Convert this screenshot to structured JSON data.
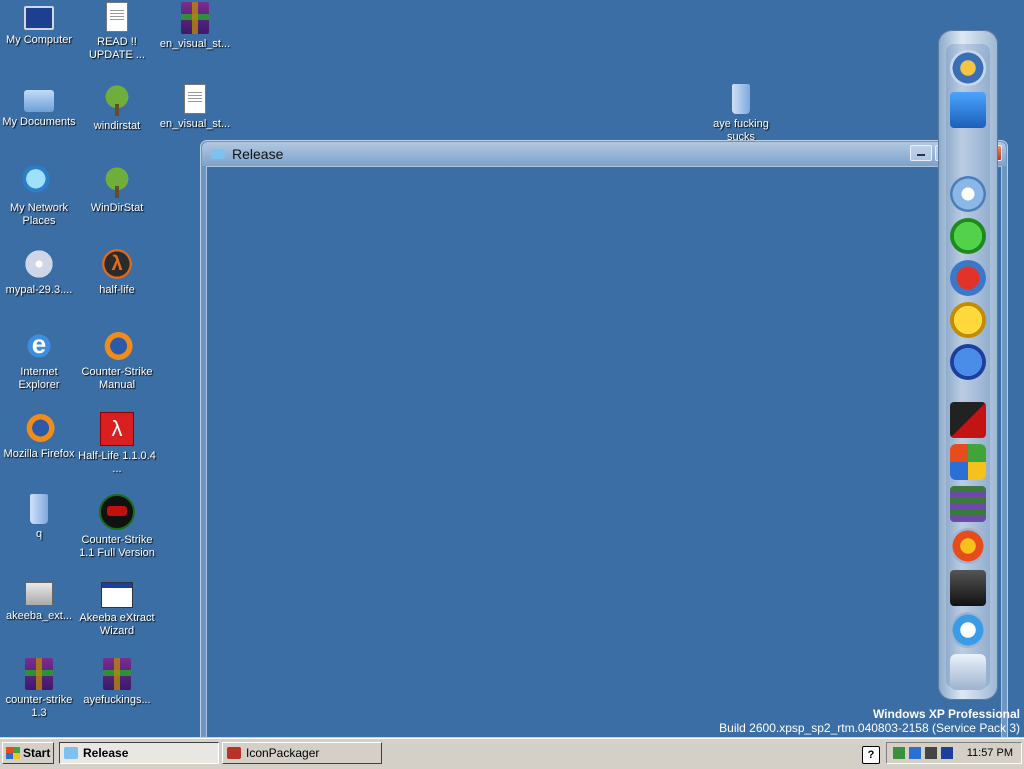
{
  "desktop_icons": [
    {
      "label": "My Computer",
      "icon": "computer-icon"
    },
    {
      "label": "READ !! UPDATE ...",
      "icon": "text-document-icon"
    },
    {
      "label": "en_visual_st...",
      "icon": "winrar-archive-icon"
    },
    {
      "label": "My Documents",
      "icon": "my-documents-icon"
    },
    {
      "label": "windirstat",
      "icon": "windirstat-tree-icon"
    },
    {
      "label": "en_visual_st...",
      "icon": "disc-image-document-icon"
    },
    {
      "label": "My Network Places",
      "icon": "network-places-icon"
    },
    {
      "label": "WinDirStat",
      "icon": "windirstat-tree-icon"
    },
    {
      "label": "mypal-29.3....",
      "icon": "installer-cd-icon"
    },
    {
      "label": "half-life",
      "icon": "half-life-icon"
    },
    {
      "label": "Internet Explorer",
      "icon": "internet-explorer-icon"
    },
    {
      "label": "Counter-Strike Manual",
      "icon": "firefox-document-icon"
    },
    {
      "label": "Mozilla Firefox",
      "icon": "firefox-icon"
    },
    {
      "label": "Half-Life 1.1.0.4 ...",
      "icon": "half-life-red-icon"
    },
    {
      "label": "q",
      "icon": "folder-icon"
    },
    {
      "label": "Counter-Strike 1.1 Full Version",
      "icon": "counter-strike-icon"
    },
    {
      "label": "akeeba_ext...",
      "icon": "setup-icon"
    },
    {
      "label": "Akeeba eXtract Wizard",
      "icon": "application-window-icon"
    },
    {
      "label": "counter-strike 1.3",
      "icon": "winrar-archive-icon"
    },
    {
      "label": "ayefuckings...",
      "icon": "winrar-archive-icon"
    },
    {
      "label": "aye fucking sucks",
      "icon": "folder-icon"
    }
  ],
  "window": {
    "title": "Release",
    "buttons": {
      "minimize": "minimize-icon",
      "maximize": "maximize-icon",
      "close": "close-icon"
    }
  },
  "dock": {
    "items": [
      "firefox-globe-icon",
      "network-monitor-icon",
      "media-player-icon",
      "internet-explorer-icon",
      "media-icon",
      "messenger-smiley-icon",
      "msn-messenger-icon",
      "video-icon",
      "windows-logo-icon",
      "books-stack-icon",
      "windows-flag-icon",
      "laptop-icon",
      "tools-icon",
      "recycle-bin-icon"
    ]
  },
  "watermark": {
    "edition": "Windows XP Professional",
    "build": "Build 2600.xpsp_sp2_rtm.040803-2158 (Service Pack 3)"
  },
  "taskbar": {
    "start_label": "Start",
    "tasks": [
      {
        "label": "Release",
        "active": true
      },
      {
        "label": "IconPackager",
        "active": false
      }
    ],
    "help_label": "?",
    "clock": "11:57 PM"
  }
}
